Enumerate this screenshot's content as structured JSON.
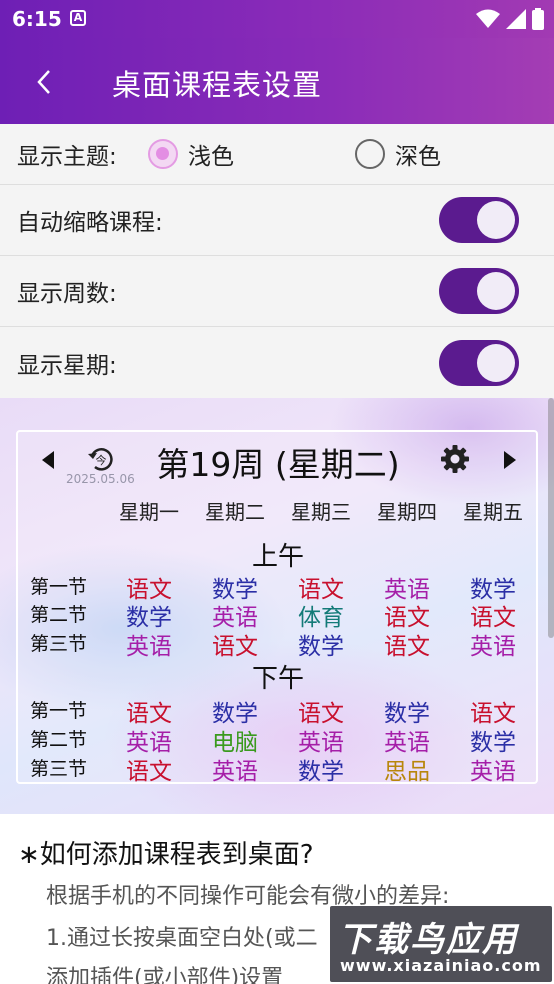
{
  "status": {
    "time": "6:15",
    "notif_letter": "A"
  },
  "appbar": {
    "title": "桌面课程表设置"
  },
  "settings": {
    "theme_label": "显示主题:",
    "theme_light": "浅色",
    "theme_dark": "深色",
    "theme_selected": "浅色",
    "auto_shrink_label": "自动缩略课程:",
    "auto_shrink_on": true,
    "show_week_label": "显示周数:",
    "show_week_on": true,
    "show_day_label": "显示星期:",
    "show_day_on": true
  },
  "widget": {
    "date": "2025.05.06",
    "week_title": "第19周 (星期二)",
    "days": [
      "星期一",
      "星期二",
      "星期三",
      "星期四",
      "星期五"
    ],
    "morning_label": "上午",
    "afternoon_label": "下午",
    "slots": [
      "第一节",
      "第二节",
      "第三节"
    ],
    "morning": [
      [
        "语文",
        "数学",
        "语文",
        "英语",
        "数学"
      ],
      [
        "数学",
        "英语",
        "体育",
        "语文",
        "语文"
      ],
      [
        "英语",
        "语文",
        "数学",
        "语文",
        "英语"
      ]
    ],
    "afternoon": [
      [
        "语文",
        "数学",
        "语文",
        "数学",
        "语文"
      ],
      [
        "英语",
        "电脑",
        "英语",
        "英语",
        "数学"
      ],
      [
        "语文",
        "英语",
        "数学",
        "思品",
        "英语"
      ]
    ],
    "subject_colors": {
      "语文": "#c8102e",
      "数学": "#2b2fa6",
      "英语": "#a51ea8",
      "体育": "#137a78",
      "电脑": "#3a9a1e",
      "思品": "#b8860b"
    }
  },
  "help": {
    "title": "∗如何添加课程表到桌面?",
    "line1": "根据手机的不同操作可能会有微小的差异:",
    "line2": "1.通过长按桌面空白处(或二",
    "line3": "添加插件(或小部件)设置"
  },
  "watermark": {
    "brand": "下载鸟应用",
    "url": "www.xiazainiao.com"
  }
}
